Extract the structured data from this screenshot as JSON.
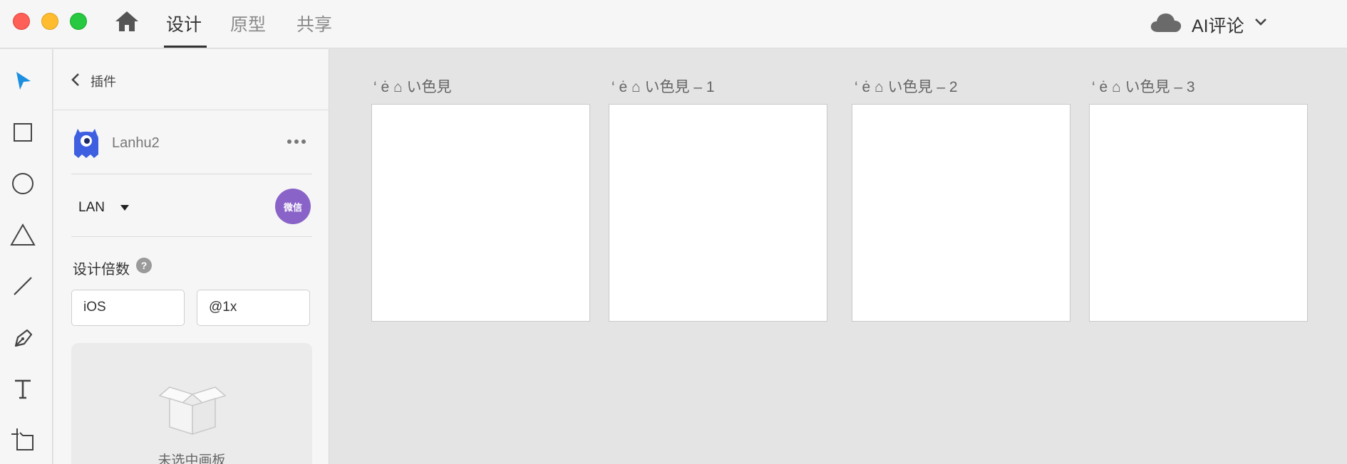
{
  "titlebar": {
    "tabs": [
      {
        "label": "设计",
        "active": true
      },
      {
        "label": "原型",
        "active": false
      },
      {
        "label": "共享",
        "active": false
      }
    ],
    "ai_review_label": "AI评论",
    "icons": [
      "home-icon",
      "cloud-icon",
      "chevron-down-icon"
    ]
  },
  "toolbar": {
    "tools": [
      "select-tool",
      "rectangle-tool",
      "ellipse-tool",
      "triangle-tool",
      "line-tool",
      "pen-tool",
      "text-tool",
      "artboard-tool"
    ],
    "active_tool": "select-tool",
    "accent_color": "#1b8fe0"
  },
  "plugin_panel": {
    "back_label": "插件",
    "plugin_name": "Lanhu2",
    "team_selector": "LAN",
    "wechat_badge": "微信",
    "scale_label": "设计倍数",
    "help_glyph": "?",
    "platform_value": "iOS",
    "multiplier_value": "@1x",
    "empty_state_text": "未选中画板",
    "badge_color": "#8a63c8"
  },
  "canvas": {
    "artboards": [
      {
        "label": "‘ ė ⌂ い色見"
      },
      {
        "label": "‘ ė ⌂ い色見 – 1"
      },
      {
        "label": "‘ ė ⌂ い色見 – 2"
      },
      {
        "label": "‘ ė ⌂ い色見 – 3"
      }
    ]
  }
}
